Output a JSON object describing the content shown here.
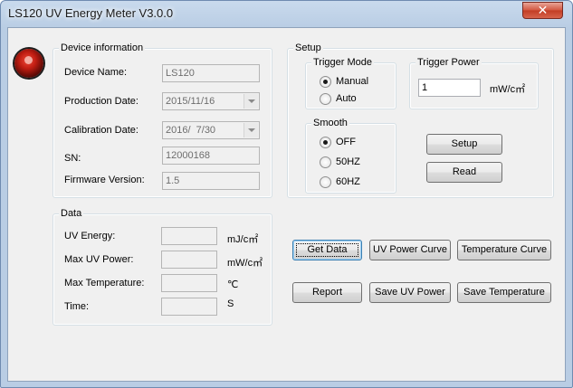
{
  "window": {
    "title": "LS120 UV Energy Meter V3.0.0",
    "close_glyph": "✕"
  },
  "device_info": {
    "legend": "Device information",
    "device_name_label": "Device Name:",
    "device_name_value": "LS120",
    "production_date_label": "Production Date:",
    "production_date_value": "2015/11/16",
    "calibration_date_label": "Calibration Date:",
    "calibration_date_value": "2016/  7/30",
    "sn_label": "SN:",
    "sn_value": "12000168",
    "firmware_label": "Firmware Version:",
    "firmware_value": "1.5"
  },
  "setup": {
    "legend": "Setup",
    "trigger_mode": {
      "legend": "Trigger Mode",
      "options": [
        "Manual",
        "Auto"
      ],
      "selected": "Manual"
    },
    "trigger_power": {
      "legend": "Trigger Power",
      "value": "1",
      "unit": "mW/c㎡"
    },
    "smooth": {
      "legend": "Smooth",
      "options": [
        "OFF",
        "50HZ",
        "60HZ"
      ],
      "selected": "OFF"
    },
    "setup_button": "Setup",
    "read_button": "Read"
  },
  "data": {
    "legend": "Data",
    "uv_energy_label": "UV Energy:",
    "uv_energy_unit": "mJ/c㎡",
    "uv_energy_value": "",
    "max_uv_power_label": "Max UV Power:",
    "max_uv_power_unit": "mW/c㎡",
    "max_uv_power_value": "",
    "max_temp_label": "Max Temperature:",
    "max_temp_unit": "℃",
    "max_temp_value": "",
    "time_label": "Time:",
    "time_unit": "S",
    "time_value": ""
  },
  "actions": {
    "get_data": "Get Data",
    "uv_power_curve": "UV Power Curve",
    "temperature_curve": "Temperature Curve",
    "report": "Report",
    "save_uv_power": "Save UV Power",
    "save_temperature": "Save Temperature"
  },
  "colors": {
    "title_bar": "#b9cde4",
    "close_button": "#c9432b",
    "client_bg": "#f0f0f0",
    "logo": "#c01d12"
  }
}
